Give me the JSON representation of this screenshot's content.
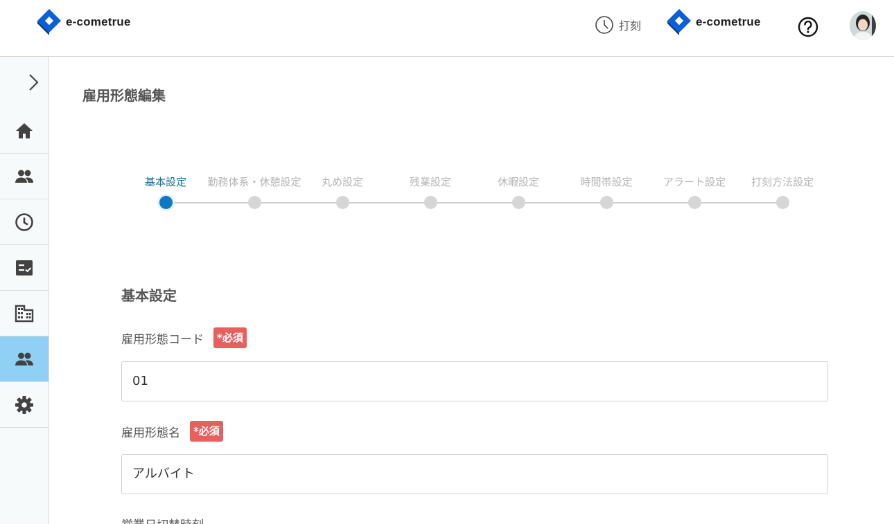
{
  "header": {
    "logo_text": "e-cometrue",
    "stamp_label": "打刻",
    "brand_text": "e-cometrue",
    "brand_color": "#0b5fd8"
  },
  "sidebar": {
    "toggle_icon": "chevron-right-icon",
    "items": [
      {
        "icon": "home-icon"
      },
      {
        "icon": "users-icon"
      },
      {
        "icon": "clock-icon"
      },
      {
        "icon": "checklist-icon"
      },
      {
        "icon": "building-icon"
      },
      {
        "icon": "users-icon",
        "active": true
      },
      {
        "icon": "gear-icon"
      }
    ],
    "active_color": "#8fd0f4"
  },
  "page": {
    "title": "雇用形態編集"
  },
  "stepper": {
    "steps": [
      {
        "label": "基本設定",
        "active": true
      },
      {
        "label": "勤務体系・休憩設定"
      },
      {
        "label": "丸め設定"
      },
      {
        "label": "残業設定"
      },
      {
        "label": "休暇設定"
      },
      {
        "label": "時間帯設定"
      },
      {
        "label": "アラート設定"
      },
      {
        "label": "打刻方法設定"
      }
    ]
  },
  "form": {
    "section_title": "基本設定",
    "fields": [
      {
        "label": "雇用形態コード",
        "required_badge": "*必須",
        "value": "01"
      },
      {
        "label": "雇用形態名",
        "required_badge": "*必須",
        "value": "アルバイト"
      }
    ],
    "next_label": "営業日切替時刻"
  }
}
